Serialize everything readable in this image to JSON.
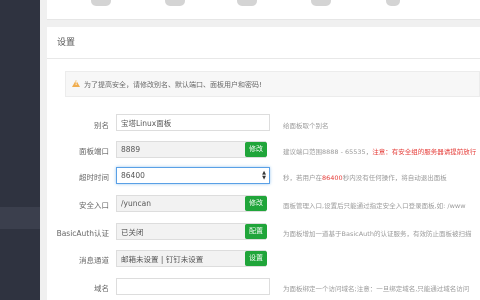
{
  "top_toggles": [
    "",
    "",
    "",
    "",
    ""
  ],
  "settings": {
    "title": "设置",
    "warning": "为了提高安全，请修改别名、默认端口、面板用户和密码!",
    "rows": {
      "alias": {
        "label": "别名",
        "value": "宝塔Linux面板",
        "help": "给面板取个别名"
      },
      "port": {
        "label": "面板端口",
        "value": "8889",
        "button": "修改",
        "help_prefix": "建议端口范围8888 - 65535，",
        "help_warn": "注意：有安全组的服务器请提前放行"
      },
      "timeout": {
        "label": "超时时间",
        "value": "86400",
        "help_prefix": "秒，若用户在",
        "help_highlight": "86400",
        "help_suffix": "秒内没有任何操作，将自动退出面板"
      },
      "entrance": {
        "label": "安全入口",
        "value": "/yuncan",
        "help": "面板管理入口,设置后只能通过指定安全入口登录面板,如: /www"
      },
      "basicauth": {
        "label": "BasicAuth认证",
        "value": "已关闭",
        "button": "配置",
        "help": "为面板增加一道基于BasicAuth的认证服务，有效防止面板被扫描"
      },
      "notify": {
        "label": "消息通道",
        "value": "邮箱未设置 | 钉钉未设置",
        "button": "设置",
        "help": ""
      },
      "domain": {
        "label": "域名",
        "value": "",
        "help": "为面板绑定一个访问域名;注意：一旦绑定域名,只能通过域名访问"
      }
    }
  }
}
